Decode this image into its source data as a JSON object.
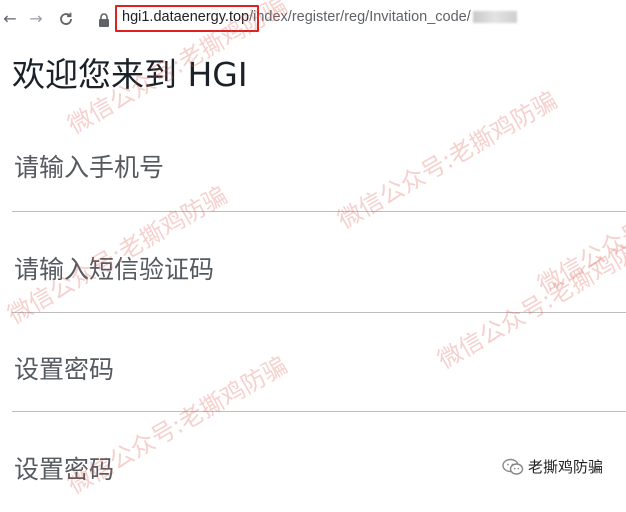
{
  "browser": {
    "url_host": "hgi1.dataenergy.top",
    "url_path": "/index/register/reg/Invitation_code/",
    "icons": [
      "back-icon",
      "forward-icon",
      "reload-icon",
      "lock-icon"
    ]
  },
  "page": {
    "title": "欢迎您来到 HGI",
    "fields": [
      {
        "placeholder": "请输入手机号"
      },
      {
        "placeholder": "请输入短信验证码"
      },
      {
        "placeholder": "设置密码"
      },
      {
        "placeholder": "设置密码"
      }
    ]
  },
  "watermark": {
    "text": "微信公众号:老撕鸡防骗",
    "color": "#dc5a50"
  },
  "logo": {
    "text": "老撕鸡防骗"
  },
  "colors": {
    "highlight_box": "#e02020",
    "title": "#1b2128",
    "placeholder": "#555a60",
    "divider": "#bdbdbd"
  }
}
